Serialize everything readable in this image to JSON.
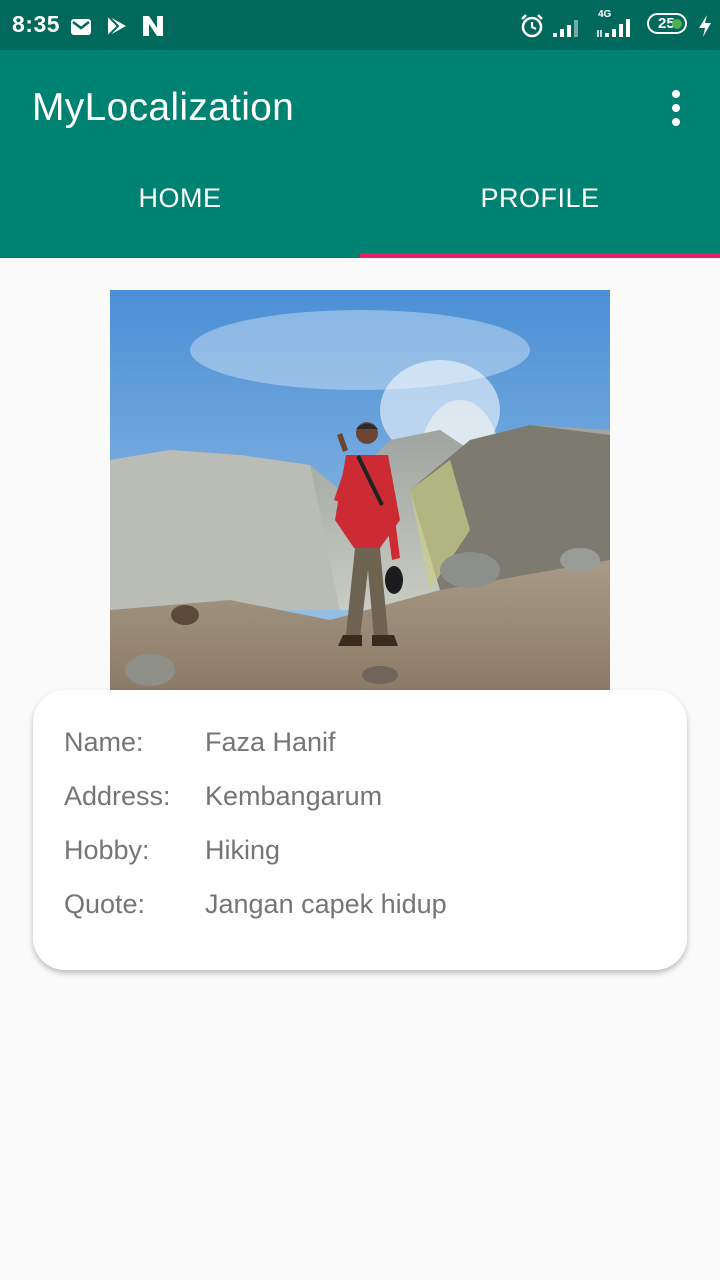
{
  "status_bar": {
    "time": "8:35",
    "network_label": "4G",
    "battery_level": "25",
    "icons": [
      "gmail-icon",
      "play-icon",
      "n-icon",
      "alarm-icon",
      "signal-icon",
      "signal-4g-icon",
      "battery-icon",
      "charging-icon"
    ]
  },
  "app_bar": {
    "title": "MyLocalization",
    "menu_icon": "more-vert-icon"
  },
  "tabs": [
    {
      "label": "HOME",
      "selected": false
    },
    {
      "label": "PROFILE",
      "selected": true
    }
  ],
  "profile": {
    "fields": [
      {
        "label": "Name:",
        "value": "Faza Hanif"
      },
      {
        "label": "Address:",
        "value": "Kembangarum"
      },
      {
        "label": "Hobby:",
        "value": "Hiking"
      },
      {
        "label": "Quote:",
        "value": "Jangan capek hidup"
      }
    ]
  },
  "colors": {
    "status_bar": "#00695c",
    "app_bar": "#008272",
    "tab_indicator": "#e91e63",
    "background": "#fafafa",
    "text_secondary": "#757575"
  }
}
